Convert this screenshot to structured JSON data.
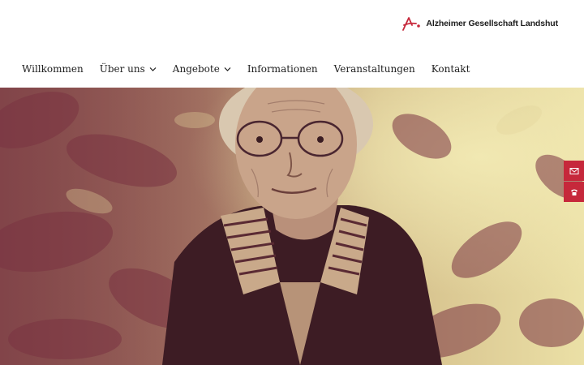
{
  "brand": {
    "name": "Alzheimer Gesellschaft Landshut",
    "logo_icon": "alzheimer-logo-icon",
    "accent": "#c6283b"
  },
  "nav": {
    "items": [
      {
        "label": "Willkommen",
        "dropdown": false
      },
      {
        "label": "Über uns",
        "dropdown": true
      },
      {
        "label": "Angebote",
        "dropdown": true
      },
      {
        "label": "Informationen",
        "dropdown": false
      },
      {
        "label": "Veranstaltungen",
        "dropdown": false
      },
      {
        "label": "Kontakt",
        "dropdown": false
      }
    ]
  },
  "hero": {
    "image": "elderly-woman-portrait",
    "tint": "#8a3b4a"
  },
  "side_buttons": [
    {
      "icon": "mail-icon"
    },
    {
      "icon": "phone-icon"
    }
  ]
}
